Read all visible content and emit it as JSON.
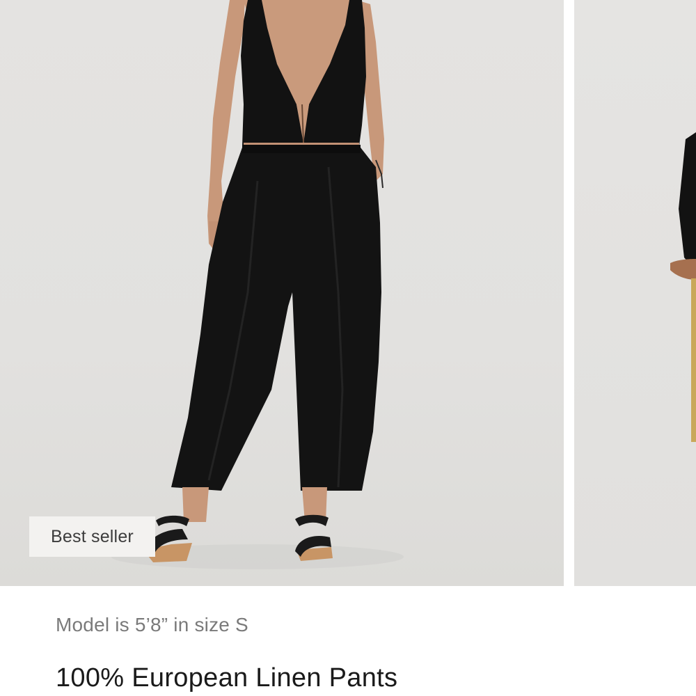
{
  "carousel": {
    "badge_label": "Best seller",
    "main_image_alt": "Model wearing black sleeveless vest and black linen pants",
    "next_image_alt": "Model seated on wooden stool"
  },
  "product": {
    "model_info": "Model is 5’8” in size S",
    "title": "100% European Linen Pants"
  },
  "colors": {
    "background": "#e2e1df",
    "garment": "#111111",
    "badge_bg": "#f3f2f0",
    "caption_text": "#7a7a7a",
    "title_text": "#1a1a1a"
  }
}
